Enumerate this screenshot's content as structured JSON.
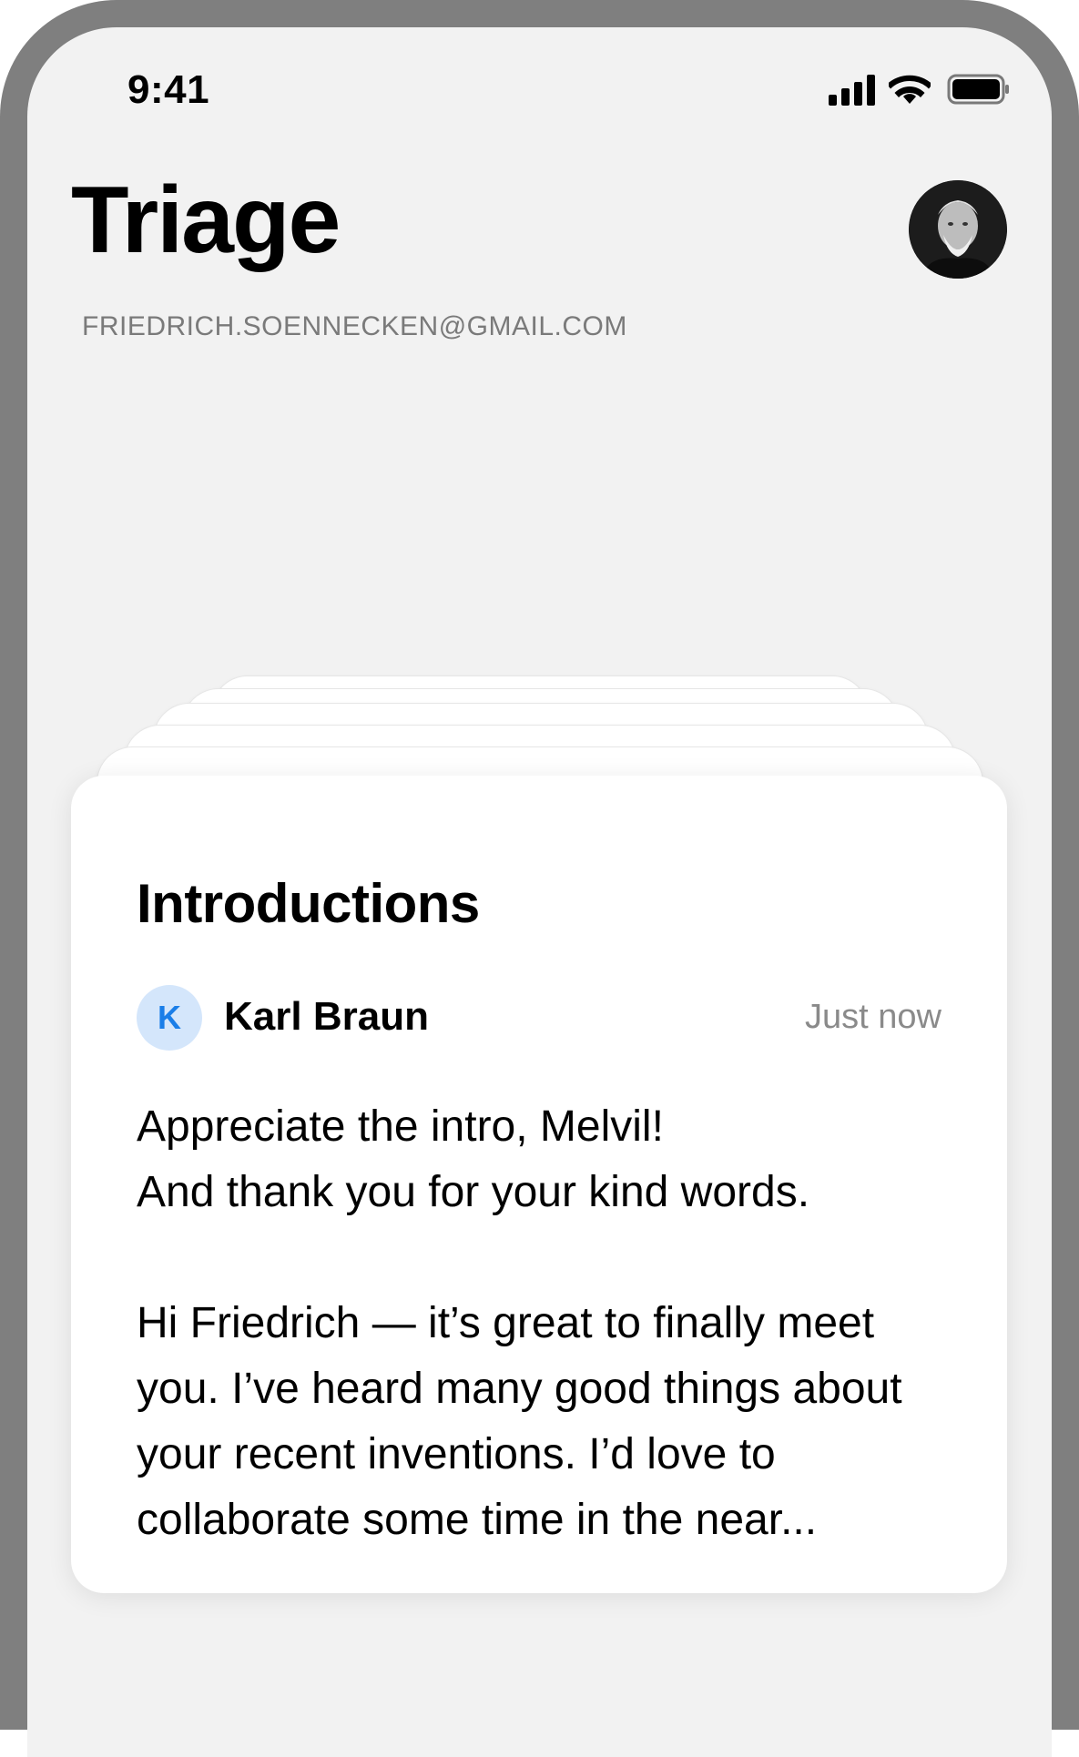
{
  "status_bar": {
    "time": "9:41",
    "icons": [
      "cellular-signal-icon",
      "wifi-icon",
      "battery-icon"
    ]
  },
  "header": {
    "title": "Triage",
    "account_email": "FRIEDRICH.SOENNECKEN@GMAIL.COM",
    "avatar": "profile-photo"
  },
  "card": {
    "title": "Introductions",
    "sender_initial": "K",
    "sender_name": "Karl Braun",
    "timestamp": "Just now",
    "body_paragraph_1_line_1": "Appreciate the intro, Melvil!",
    "body_paragraph_1_line_2": "And thank you for your kind words.",
    "body_paragraph_2": "Hi Friedrich — it’s great to finally meet you. I’ve heard many good things about your recent inventions. I’d love to collaborate some time in the near..."
  },
  "colors": {
    "frame": "#7f7f7f",
    "screen_background": "#f2f2f2",
    "card_background": "#ffffff",
    "sender_avatar_bg": "#d4e6fb",
    "sender_avatar_fg": "#1a7ee8",
    "secondary_text": "#7a7a7a"
  }
}
